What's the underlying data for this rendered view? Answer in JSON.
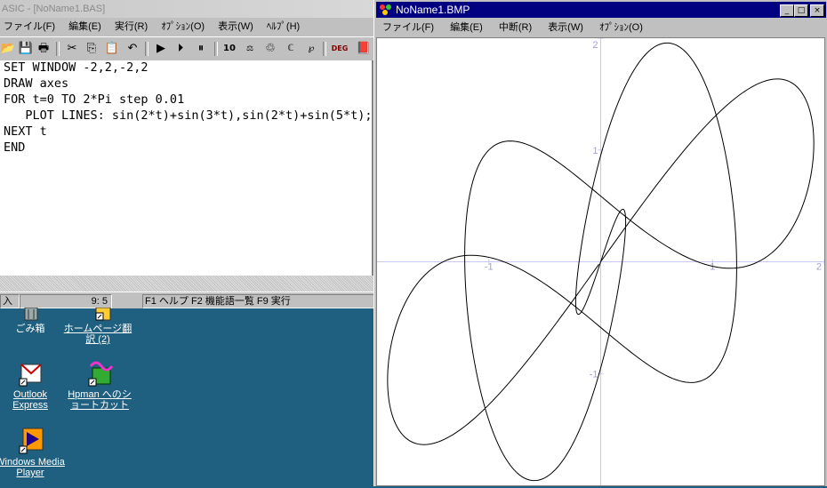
{
  "basic_window": {
    "title": "ASIC - [NoName1.BAS]",
    "menu": [
      "ファイル(F)",
      "編集(E)",
      "実行(R)",
      "ｵﾌﾟｼｮﾝ(O)",
      "表示(W)",
      "ﾍﾙﾌﾟ(H)"
    ],
    "toolbar": {
      "open_icon": "folder-open-icon",
      "save_icon": "floppy-disk-icon",
      "print_icon": "printer-icon",
      "cut_icon": "scissors-icon",
      "copy_icon": "copy-icon",
      "paste_icon": "paste-icon",
      "undo_icon": "undo-icon",
      "run_icon": "play-icon",
      "step_icon": "step-icon",
      "pause_icon": "pause-icon",
      "deg_label": "DEG"
    },
    "code_lines": [
      "SET WINDOW -2,2,-2,2",
      "DRAW axes",
      "FOR t=0 TO 2*Pi step 0.01",
      "   PLOT LINES: sin(2*t)+sin(3*t),sin(2*t)+sin(5*t);",
      "NEXT t",
      "END"
    ],
    "status": {
      "mode": "入",
      "cursor": "9:  5",
      "hints": "F1 ヘルプ  F2 機能語一覧  F9 実行"
    }
  },
  "desktop_icons": [
    {
      "label": "ごみ箱",
      "icon": "recycle-bin-icon"
    },
    {
      "label": "ホームページ翻訳 (2)",
      "icon": "translate-shortcut-icon"
    },
    {
      "label": "Outlook Express",
      "icon": "outlook-express-icon"
    },
    {
      "label": "Hpman へのショートカット",
      "icon": "hpman-shortcut-icon"
    },
    {
      "label": "Windows Media Player",
      "icon": "media-player-icon"
    }
  ],
  "graph_window": {
    "title": "NoName1.BMP",
    "menu": [
      "ファイル(F)",
      "編集(E)",
      "中断(R)",
      "表示(W)",
      "ｵﾌﾟｼｮﾝ(O)"
    ],
    "buttons": {
      "minimize": "_",
      "maximize": "□",
      "close": "×"
    },
    "plot": {
      "x_range": [
        -2,
        2
      ],
      "y_range": [
        -2,
        2
      ],
      "x_tick_labels": [
        "-1",
        "1",
        "2"
      ],
      "y_tick_labels": [
        "2",
        "1",
        "-1"
      ],
      "axis_color": "#c8c8f0",
      "curve_color": "#000000",
      "t_start": 0,
      "t_end": 6.2832,
      "t_step": 0.01
    }
  },
  "colors": {
    "desktop": "#1f5f7f",
    "title_active": "#000080",
    "face": "#c0c0c0"
  }
}
